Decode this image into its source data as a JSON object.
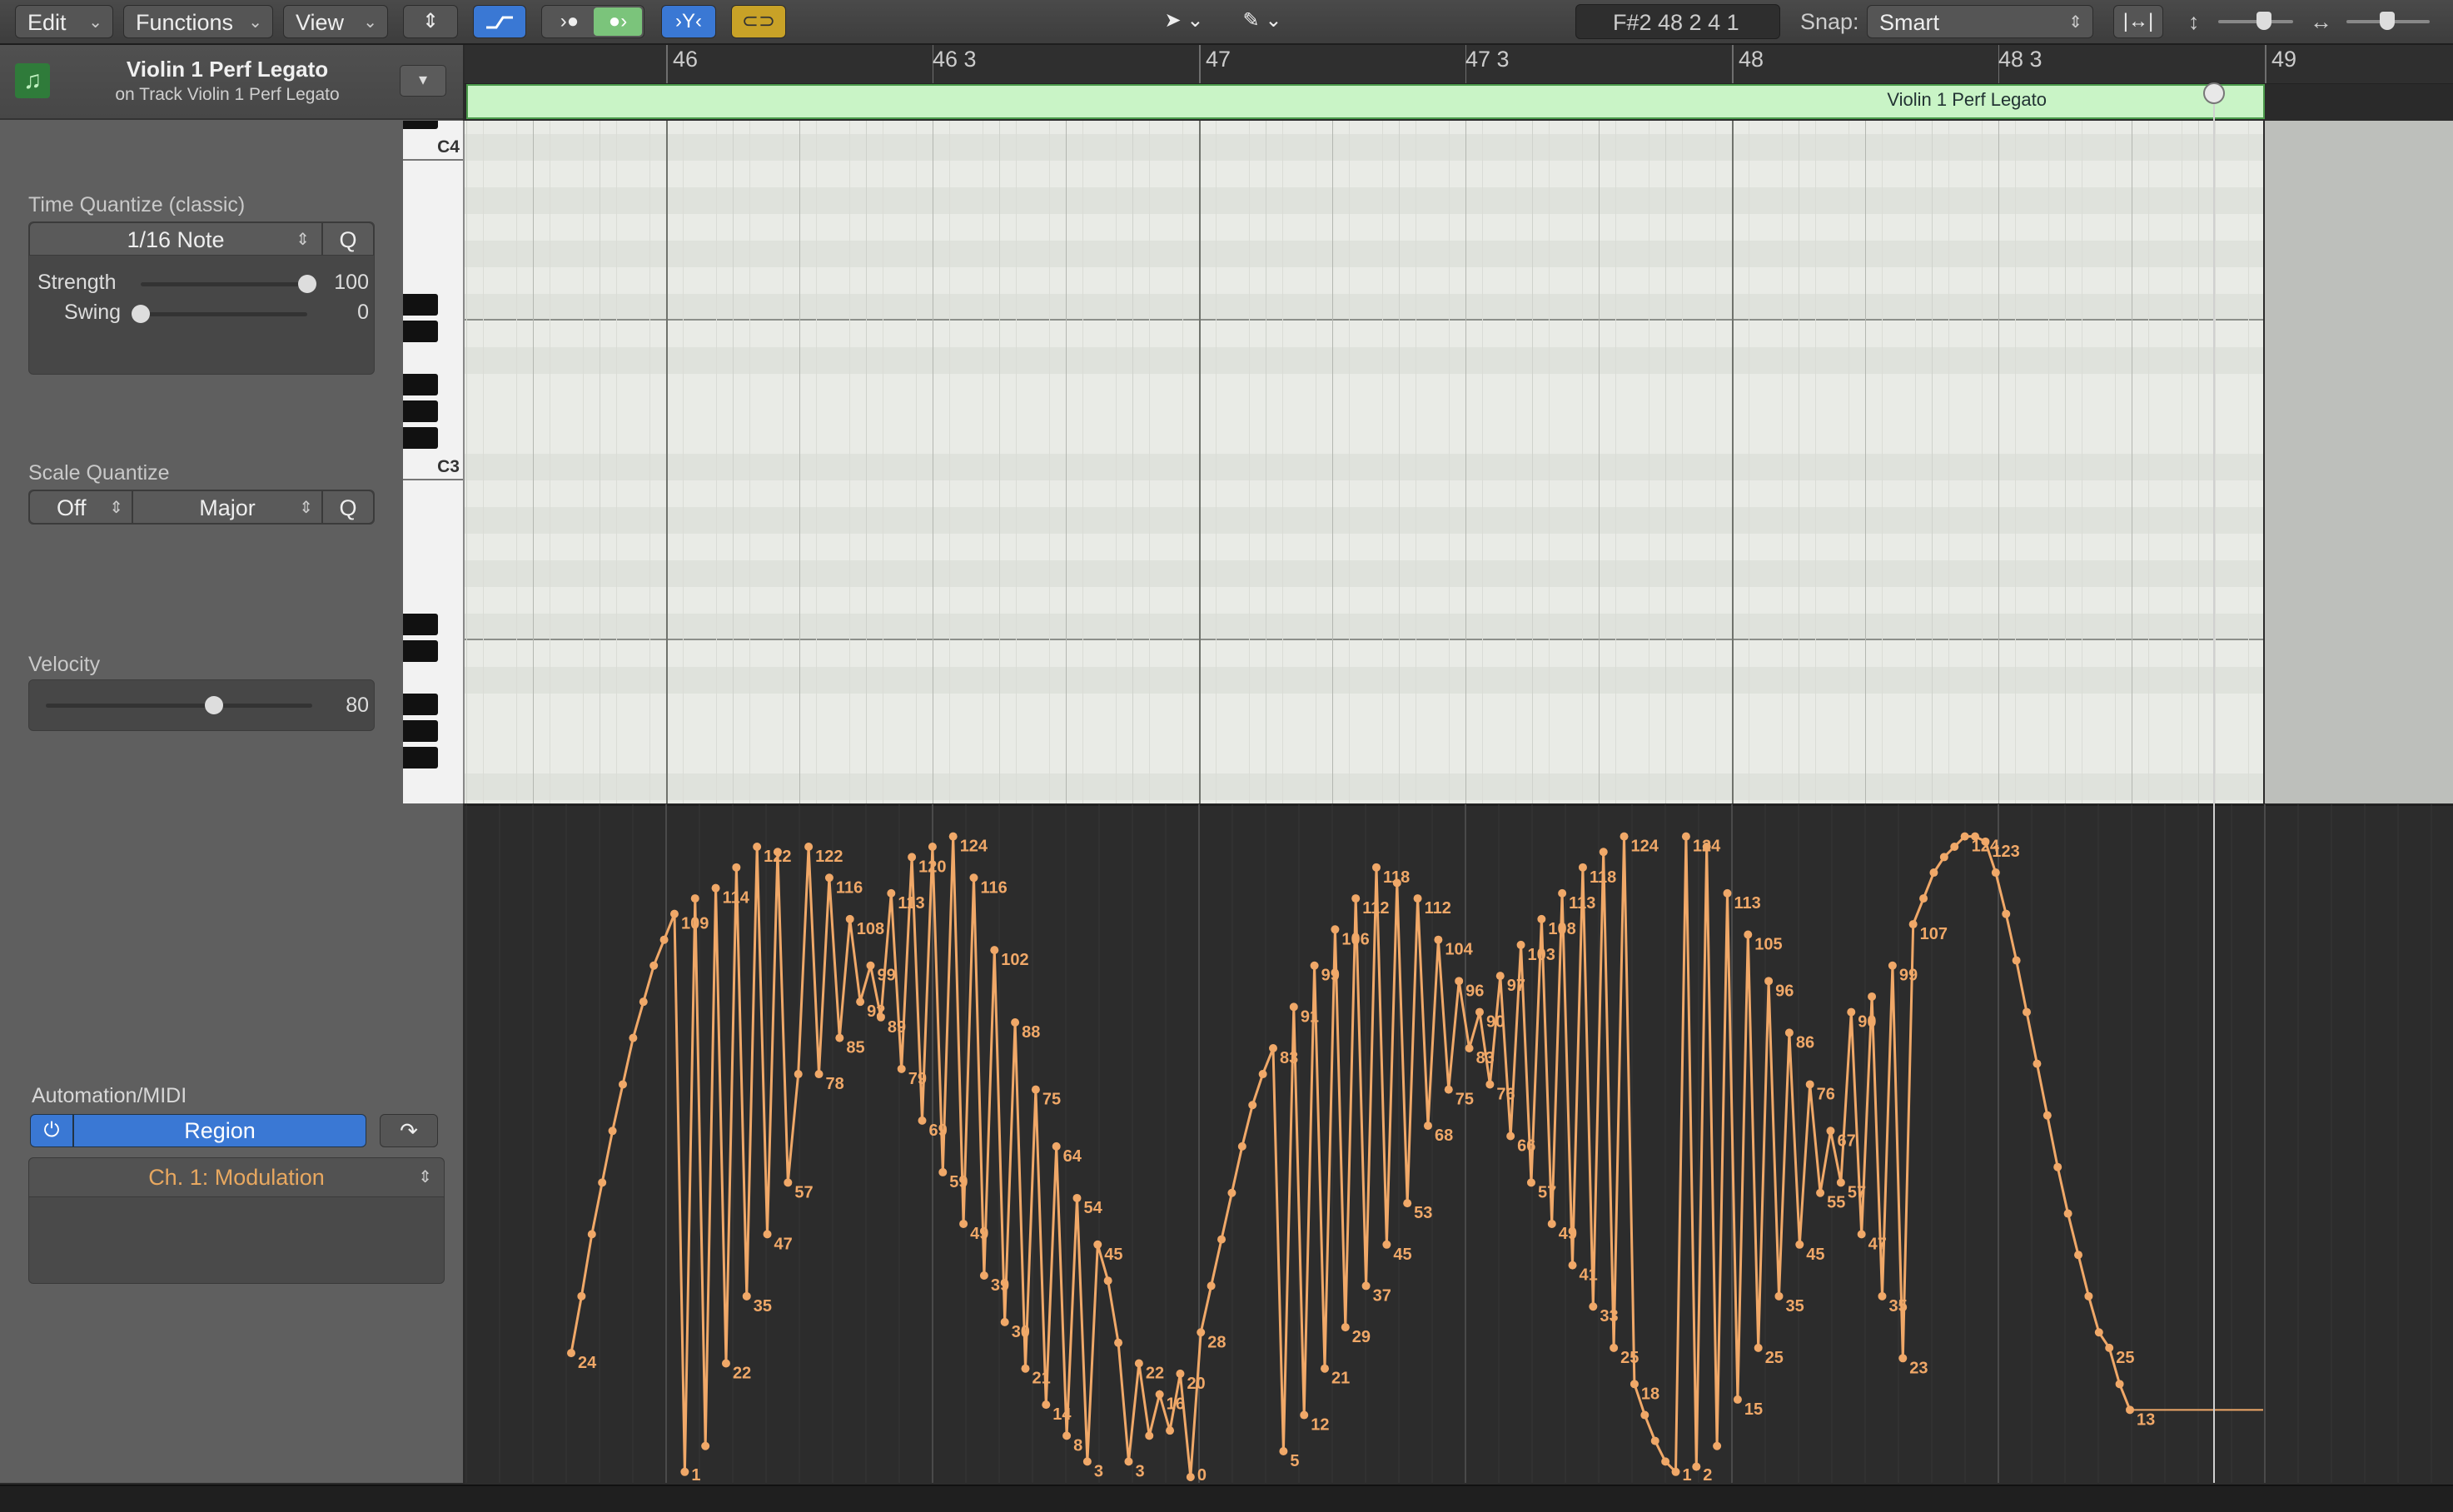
{
  "toolbar": {
    "menus": [
      {
        "label": "Edit"
      },
      {
        "label": "Functions"
      },
      {
        "label": "View"
      }
    ],
    "position_display": "F#2   48 2 4 1",
    "snap_label": "Snap:",
    "snap_value": "Smart"
  },
  "inspector": {
    "track_title": "Violin 1 Perf Legato",
    "track_subtitle": "on Track Violin 1 Perf Legato",
    "time_quantize": {
      "heading": "Time Quantize (classic)",
      "value": "1/16 Note",
      "q_label": "Q",
      "strength_label": "Strength",
      "strength_value": "100",
      "strength_level": 1.0,
      "swing_label": "Swing",
      "swing_value": "0",
      "swing_level": 0.0
    },
    "scale_quantize": {
      "heading": "Scale Quantize",
      "root": "Off",
      "scale": "Major",
      "q_label": "Q"
    },
    "velocity": {
      "heading": "Velocity",
      "value": "80",
      "level": 0.63
    },
    "automation": {
      "heading": "Automation/MIDI",
      "mode": "Region",
      "parameter": "Ch. 1: Modulation"
    }
  },
  "ruler": {
    "labels": [
      "46",
      "46 3",
      "47",
      "47 3",
      "48",
      "48 3",
      "49"
    ]
  },
  "region": {
    "name": "Violin 1 Perf Legato"
  },
  "keyboard": {
    "labels": [
      "C4",
      "C3"
    ]
  },
  "automation_points": [
    {
      "v": 24,
      "l": "24"
    },
    {
      "v": 35
    },
    {
      "v": 47
    },
    {
      "v": 57
    },
    {
      "v": 67
    },
    {
      "v": 76
    },
    {
      "v": 85
    },
    {
      "v": 92
    },
    {
      "v": 99
    },
    {
      "v": 104
    },
    {
      "v": 109,
      "l": "109"
    },
    {
      "v": 1,
      "l": "1"
    },
    {
      "v": 112
    },
    {
      "v": 6
    },
    {
      "v": 114,
      "l": "114"
    },
    {
      "v": 22,
      "l": "22"
    },
    {
      "v": 118
    },
    {
      "v": 35,
      "l": "35"
    },
    {
      "v": 122,
      "l": "122"
    },
    {
      "v": 47,
      "l": "47"
    },
    {
      "v": 121
    },
    {
      "v": 57,
      "l": "57"
    },
    {
      "v": 78
    },
    {
      "v": 122,
      "l": "122"
    },
    {
      "v": 78,
      "l": "78"
    },
    {
      "v": 116,
      "l": "116"
    },
    {
      "v": 85,
      "l": "85"
    },
    {
      "v": 108,
      "l": "108"
    },
    {
      "v": 92,
      "l": "92"
    },
    {
      "v": 99,
      "l": "99"
    },
    {
      "v": 89,
      "l": "89"
    },
    {
      "v": 113,
      "l": "113"
    },
    {
      "v": 79,
      "l": "79"
    },
    {
      "v": 120,
      "l": "120"
    },
    {
      "v": 69,
      "l": "69"
    },
    {
      "v": 122
    },
    {
      "v": 59,
      "l": "59"
    },
    {
      "v": 124,
      "l": "124"
    },
    {
      "v": 49,
      "l": "49"
    },
    {
      "v": 116,
      "l": "116"
    },
    {
      "v": 39,
      "l": "39"
    },
    {
      "v": 102,
      "l": "102"
    },
    {
      "v": 30,
      "l": "30"
    },
    {
      "v": 88,
      "l": "88"
    },
    {
      "v": 21,
      "l": "21"
    },
    {
      "v": 75,
      "l": "75"
    },
    {
      "v": 14,
      "l": "14"
    },
    {
      "v": 64,
      "l": "64"
    },
    {
      "v": 8,
      "l": "8"
    },
    {
      "v": 54,
      "l": "54"
    },
    {
      "v": 3,
      "l": "3"
    },
    {
      "v": 45,
      "l": "45"
    },
    {
      "v": 38
    },
    {
      "v": 26
    },
    {
      "v": 3,
      "l": "3"
    },
    {
      "v": 22,
      "l": "22"
    },
    {
      "v": 8
    },
    {
      "v": 16,
      "l": "16"
    },
    {
      "v": 9
    },
    {
      "v": 20,
      "l": "20"
    },
    {
      "v": 0,
      "l": "0"
    },
    {
      "v": 28,
      "l": "28"
    },
    {
      "v": 37
    },
    {
      "v": 46
    },
    {
      "v": 55
    },
    {
      "v": 64
    },
    {
      "v": 72
    },
    {
      "v": 78
    },
    {
      "v": 83,
      "l": "83"
    },
    {
      "v": 5,
      "l": "5"
    },
    {
      "v": 91,
      "l": "91"
    },
    {
      "v": 12,
      "l": "12"
    },
    {
      "v": 99,
      "l": "99"
    },
    {
      "v": 21,
      "l": "21"
    },
    {
      "v": 106,
      "l": "106"
    },
    {
      "v": 29,
      "l": "29"
    },
    {
      "v": 112,
      "l": "112"
    },
    {
      "v": 37,
      "l": "37"
    },
    {
      "v": 118,
      "l": "118"
    },
    {
      "v": 45,
      "l": "45"
    },
    {
      "v": 115
    },
    {
      "v": 53,
      "l": "53"
    },
    {
      "v": 112,
      "l": "112"
    },
    {
      "v": 68,
      "l": "68"
    },
    {
      "v": 104,
      "l": "104"
    },
    {
      "v": 75,
      "l": "75"
    },
    {
      "v": 96,
      "l": "96"
    },
    {
      "v": 83,
      "l": "83"
    },
    {
      "v": 90,
      "l": "90"
    },
    {
      "v": 76,
      "l": "76"
    },
    {
      "v": 97,
      "l": "97"
    },
    {
      "v": 66,
      "l": "66"
    },
    {
      "v": 103,
      "l": "103"
    },
    {
      "v": 57,
      "l": "57"
    },
    {
      "v": 108,
      "l": "108"
    },
    {
      "v": 49,
      "l": "49"
    },
    {
      "v": 113,
      "l": "113"
    },
    {
      "v": 41,
      "l": "41"
    },
    {
      "v": 118,
      "l": "118"
    },
    {
      "v": 33,
      "l": "33"
    },
    {
      "v": 121
    },
    {
      "v": 25,
      "l": "25"
    },
    {
      "v": 124,
      "l": "124"
    },
    {
      "v": 18,
      "l": "18"
    },
    {
      "v": 12
    },
    {
      "v": 7
    },
    {
      "v": 3
    },
    {
      "v": 1,
      "l": "1"
    },
    {
      "v": 124,
      "l": "124"
    },
    {
      "v": 2,
      "l": "2"
    },
    {
      "v": 122
    },
    {
      "v": 6
    },
    {
      "v": 113,
      "l": "113"
    },
    {
      "v": 15,
      "l": "15"
    },
    {
      "v": 105,
      "l": "105"
    },
    {
      "v": 25,
      "l": "25"
    },
    {
      "v": 96,
      "l": "96"
    },
    {
      "v": 35,
      "l": "35"
    },
    {
      "v": 86,
      "l": "86"
    },
    {
      "v": 45,
      "l": "45"
    },
    {
      "v": 76,
      "l": "76"
    },
    {
      "v": 55,
      "l": "55"
    },
    {
      "v": 67,
      "l": "67"
    },
    {
      "v": 57,
      "l": "57"
    },
    {
      "v": 90,
      "l": "90"
    },
    {
      "v": 47,
      "l": "47"
    },
    {
      "v": 93
    },
    {
      "v": 35,
      "l": "35"
    },
    {
      "v": 99,
      "l": "99"
    },
    {
      "v": 23,
      "l": "23"
    },
    {
      "v": 107,
      "l": "107"
    },
    {
      "v": 112
    },
    {
      "v": 117
    },
    {
      "v": 120
    },
    {
      "v": 122
    },
    {
      "v": 124,
      "l": "124"
    },
    {
      "v": 124
    },
    {
      "v": 123,
      "l": "123"
    },
    {
      "v": 117
    },
    {
      "v": 109
    },
    {
      "v": 100
    },
    {
      "v": 90
    },
    {
      "v": 80
    },
    {
      "v": 70
    },
    {
      "v": 60
    },
    {
      "v": 51
    },
    {
      "v": 43
    },
    {
      "v": 35
    },
    {
      "v": 28
    },
    {
      "v": 25,
      "l": "25"
    },
    {
      "v": 18
    },
    {
      "v": 13,
      "l": "13"
    }
  ]
}
